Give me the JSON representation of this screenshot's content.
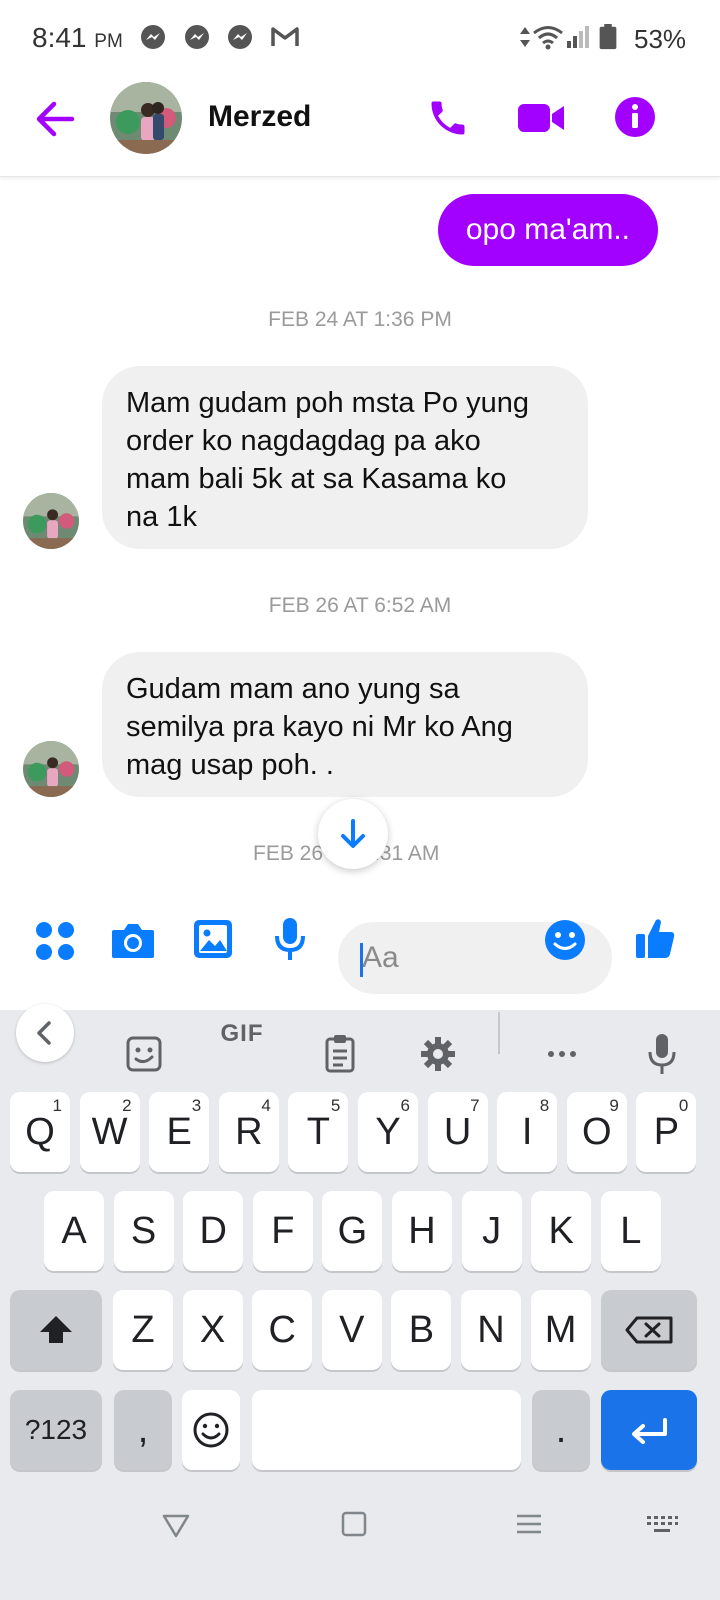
{
  "status_bar": {
    "time": "8:41",
    "ampm": "PM",
    "battery": "53%",
    "notification_icons": [
      "messenger-icon",
      "messenger-icon",
      "messenger-icon",
      "gmail-icon"
    ]
  },
  "header": {
    "contact_name": "Merzed",
    "accent": "#a200ff"
  },
  "messages": [
    {
      "type": "outgoing",
      "text": "opo ma'am.."
    },
    {
      "type": "timestamp",
      "text": "FEB 24 AT 1:36 PM"
    },
    {
      "type": "incoming",
      "lines": [
        "Mam gudam poh msta Po yung",
        "order ko nagdagdag pa ako",
        "mam bali 5k  at sa Kasama ko",
        "na 1k"
      ]
    },
    {
      "type": "timestamp",
      "text": "FEB 26 AT 6:52 AM"
    },
    {
      "type": "incoming",
      "lines": [
        "Gudam mam ano yung sa",
        "semilya pra kayo ni Mr ko Ang",
        "mag usap poh. ."
      ]
    },
    {
      "type": "timestamp",
      "left": "FEB 26",
      "right": ":31 AM"
    }
  ],
  "composer": {
    "placeholder": "Aa",
    "accent": "#0a7cff"
  },
  "keyboard": {
    "toolbar": {
      "gif_label": "GIF"
    },
    "row1": [
      {
        "k": "Q",
        "h": "1"
      },
      {
        "k": "W",
        "h": "2"
      },
      {
        "k": "E",
        "h": "3"
      },
      {
        "k": "R",
        "h": "4"
      },
      {
        "k": "T",
        "h": "5"
      },
      {
        "k": "Y",
        "h": "6"
      },
      {
        "k": "U",
        "h": "7"
      },
      {
        "k": "I",
        "h": "8"
      },
      {
        "k": "O",
        "h": "9"
      },
      {
        "k": "P",
        "h": "0"
      }
    ],
    "row2": [
      "A",
      "S",
      "D",
      "F",
      "G",
      "H",
      "J",
      "K",
      "L"
    ],
    "row3": [
      "Z",
      "X",
      "C",
      "V",
      "B",
      "N",
      "M"
    ],
    "symbols_label": "?123",
    "comma_label": ",",
    "period_label": ".",
    "enter_color": "#1a73e8"
  }
}
